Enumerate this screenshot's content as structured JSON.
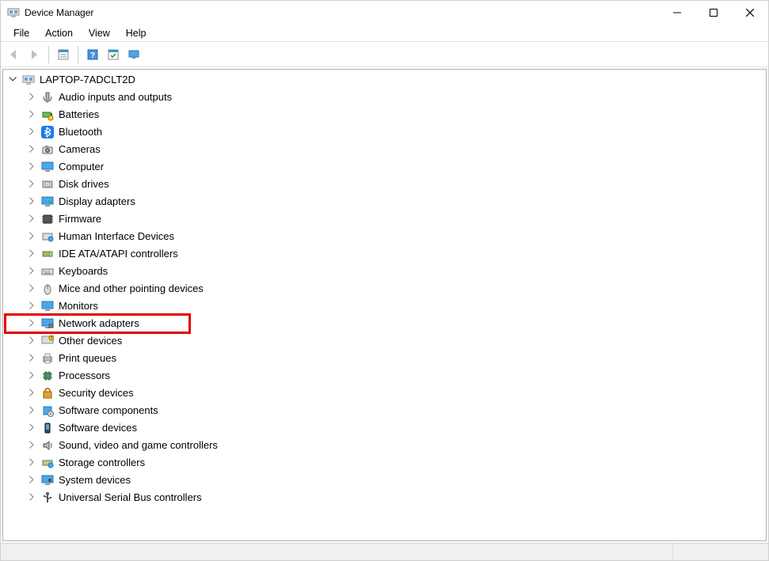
{
  "window": {
    "title": "Device Manager"
  },
  "menu": {
    "items": [
      "File",
      "Action",
      "View",
      "Help"
    ]
  },
  "toolbar": {
    "icons": [
      "back",
      "forward",
      "sep",
      "show-hide",
      "sep",
      "help",
      "action",
      "monitor"
    ]
  },
  "tree": {
    "root": {
      "label": "LAPTOP-7ADCLT2D",
      "expanded": true
    },
    "children": [
      {
        "label": "Audio inputs and outputs",
        "icon": "audio"
      },
      {
        "label": "Batteries",
        "icon": "battery"
      },
      {
        "label": "Bluetooth",
        "icon": "bluetooth"
      },
      {
        "label": "Cameras",
        "icon": "camera"
      },
      {
        "label": "Computer",
        "icon": "computer"
      },
      {
        "label": "Disk drives",
        "icon": "disk"
      },
      {
        "label": "Display adapters",
        "icon": "display"
      },
      {
        "label": "Firmware",
        "icon": "firmware"
      },
      {
        "label": "Human Interface Devices",
        "icon": "hid"
      },
      {
        "label": "IDE ATA/ATAPI controllers",
        "icon": "ide"
      },
      {
        "label": "Keyboards",
        "icon": "keyboard"
      },
      {
        "label": "Mice and other pointing devices",
        "icon": "mouse"
      },
      {
        "label": "Monitors",
        "icon": "monitor"
      },
      {
        "label": "Network adapters",
        "icon": "network",
        "highlighted": true
      },
      {
        "label": "Other devices",
        "icon": "other"
      },
      {
        "label": "Print queues",
        "icon": "printer"
      },
      {
        "label": "Processors",
        "icon": "cpu"
      },
      {
        "label": "Security devices",
        "icon": "security"
      },
      {
        "label": "Software components",
        "icon": "software"
      },
      {
        "label": "Software devices",
        "icon": "softdev"
      },
      {
        "label": "Sound, video and game controllers",
        "icon": "sound"
      },
      {
        "label": "Storage controllers",
        "icon": "storage"
      },
      {
        "label": "System devices",
        "icon": "system"
      },
      {
        "label": "Universal Serial Bus controllers",
        "icon": "usb"
      }
    ]
  }
}
